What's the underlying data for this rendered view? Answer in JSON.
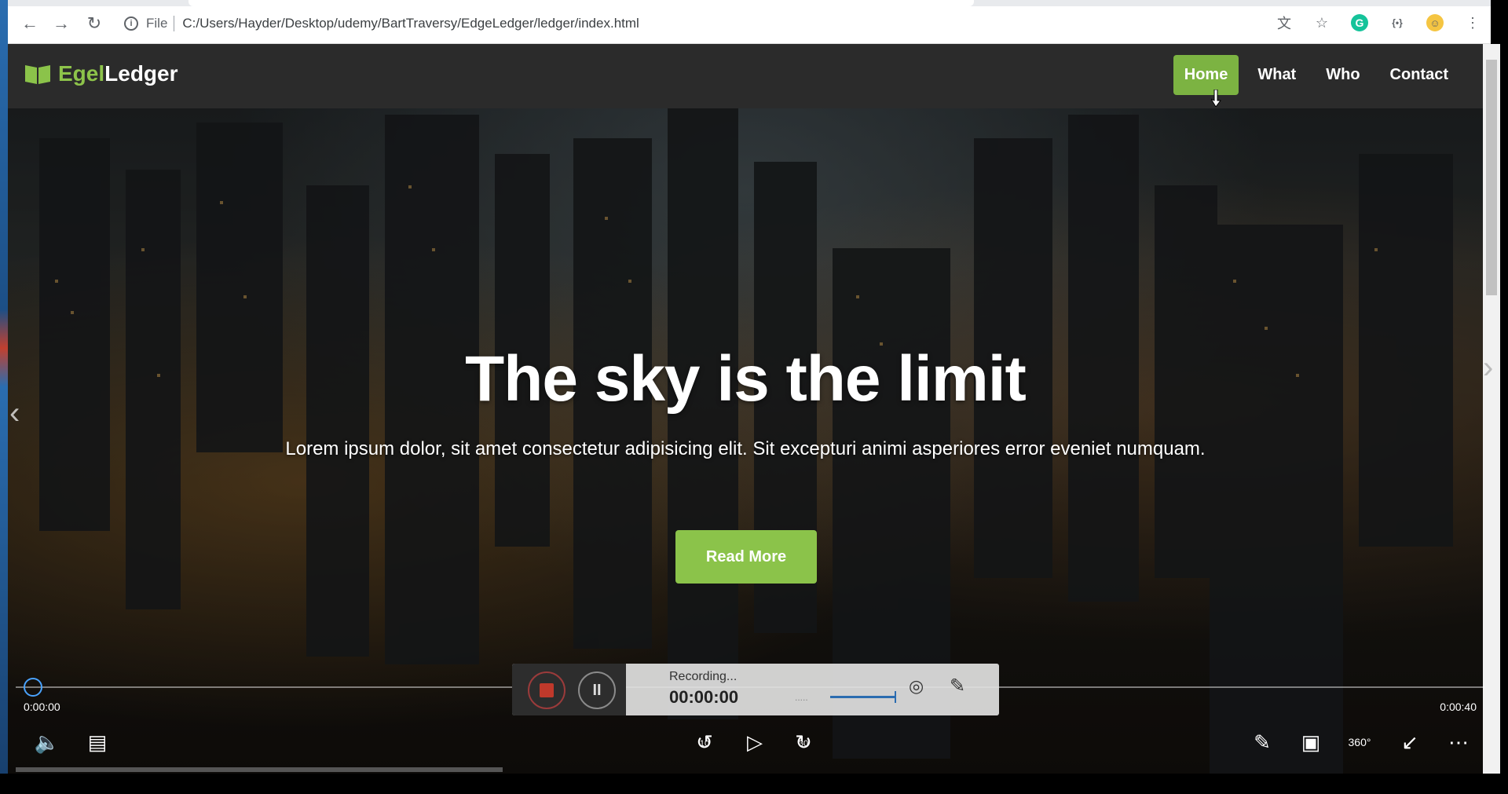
{
  "browser": {
    "scheme": "File",
    "url": "C:/Users/Hayder/Desktop/udemy/BartTraversy/EdgeLedger/ledger/index.html"
  },
  "site": {
    "brand_part1": "Egel",
    "brand_part2": "Ledger",
    "nav": [
      "Home",
      "What",
      "Who",
      "Contact"
    ],
    "active_nav": "Home",
    "hero_title": "The sky is the limit",
    "hero_text": "Lorem ipsum dolor, sit amet consectetur adipisicing elit. Sit excepturi animi asperiores error eveniet numquam.",
    "cta_label": "Read More",
    "accent_color": "#8bc34a"
  },
  "player": {
    "current_time": "0:00:00",
    "total_time": "0:00:40",
    "skip_back": "10",
    "skip_forward": "30"
  },
  "recorder": {
    "status": "Recording...",
    "elapsed": "00:00:00",
    "dots": "....."
  }
}
